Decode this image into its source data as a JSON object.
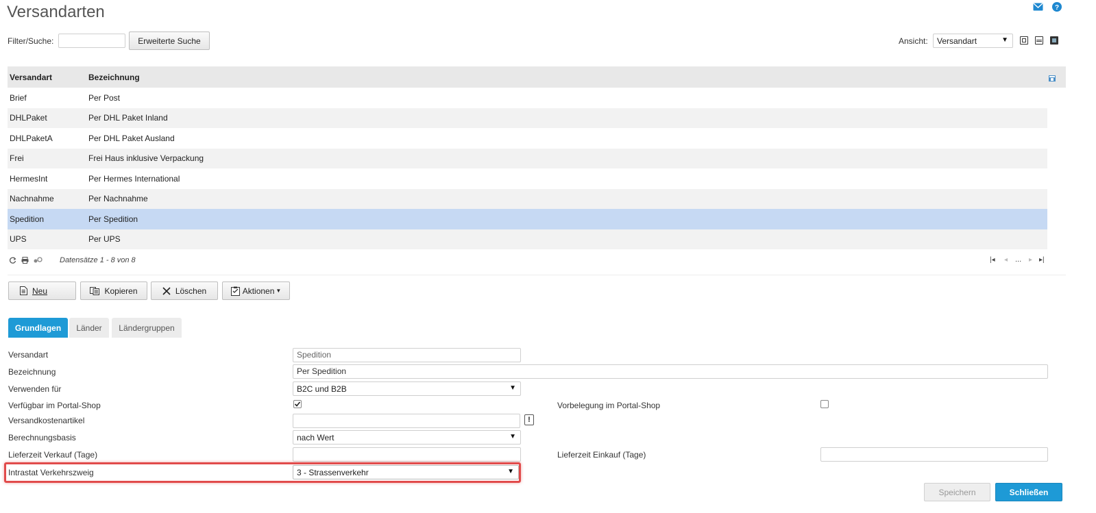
{
  "header": {
    "title": "Versandarten",
    "mail_icon": "mail-icon",
    "help_icon": "help-icon"
  },
  "filter": {
    "label": "Filter/Suche:",
    "value": "",
    "advanced_search_label": "Erweiterte Suche",
    "view_label": "Ansicht:",
    "view_value": "Versandart"
  },
  "grid": {
    "columns": [
      "Versandart",
      "Bezeichnung"
    ],
    "rows": [
      {
        "code": "Brief",
        "name": "Per Post"
      },
      {
        "code": "DHLPaket",
        "name": "Per DHL Paket Inland"
      },
      {
        "code": "DHLPaketA",
        "name": "Per DHL Paket Ausland"
      },
      {
        "code": "Frei",
        "name": "Frei Haus inklusive Verpackung"
      },
      {
        "code": "HermesInt",
        "name": "Per Hermes International"
      },
      {
        "code": "Nachnahme",
        "name": "Per Nachnahme"
      },
      {
        "code": "Spedition",
        "name": "Per Spedition"
      },
      {
        "code": "UPS",
        "name": "Per UPS"
      }
    ],
    "selected_index": 6,
    "record_info": "Datensätze 1 - 8 von 8",
    "pager_ellipsis": "..."
  },
  "actions": {
    "new": "Neu",
    "copy": "Kopieren",
    "delete": "Löschen",
    "actions": "Aktionen"
  },
  "tabs": [
    "Grundlagen",
    "Länder",
    "Ländergruppen"
  ],
  "form": {
    "versandart_label": "Versandart",
    "versandart_value": "Spedition",
    "bezeichnung_label": "Bezeichnung",
    "bezeichnung_value": "Per Spedition",
    "verwenden_label": "Verwenden für",
    "verwenden_value": "B2C und B2B",
    "portal_label": "Verfügbar im Portal-Shop",
    "portal_checked": true,
    "vorbelegung_label": "Vorbelegung im Portal-Shop",
    "vorbelegung_checked": false,
    "kostenartikel_label": "Versandkostenartikel",
    "kostenartikel_value": "",
    "berechnung_label": "Berechnungsbasis",
    "berechnung_value": "nach Wert",
    "lieferzeit_vk_label": "Lieferzeit Verkauf (Tage)",
    "lieferzeit_vk_value": "",
    "lieferzeit_ek_label": "Lieferzeit Einkauf (Tage)",
    "lieferzeit_ek_value": "",
    "intrastat_label": "Intrastat Verkehrszweig",
    "intrastat_value": "3 - Strassenverkehr",
    "excl_symbol": "!"
  },
  "footer": {
    "save": "Speichern",
    "close": "Schließen"
  },
  "colors": {
    "accent": "#1e9ad6",
    "selected_row": "#c6d9f3",
    "highlight": "#e14b4b"
  }
}
